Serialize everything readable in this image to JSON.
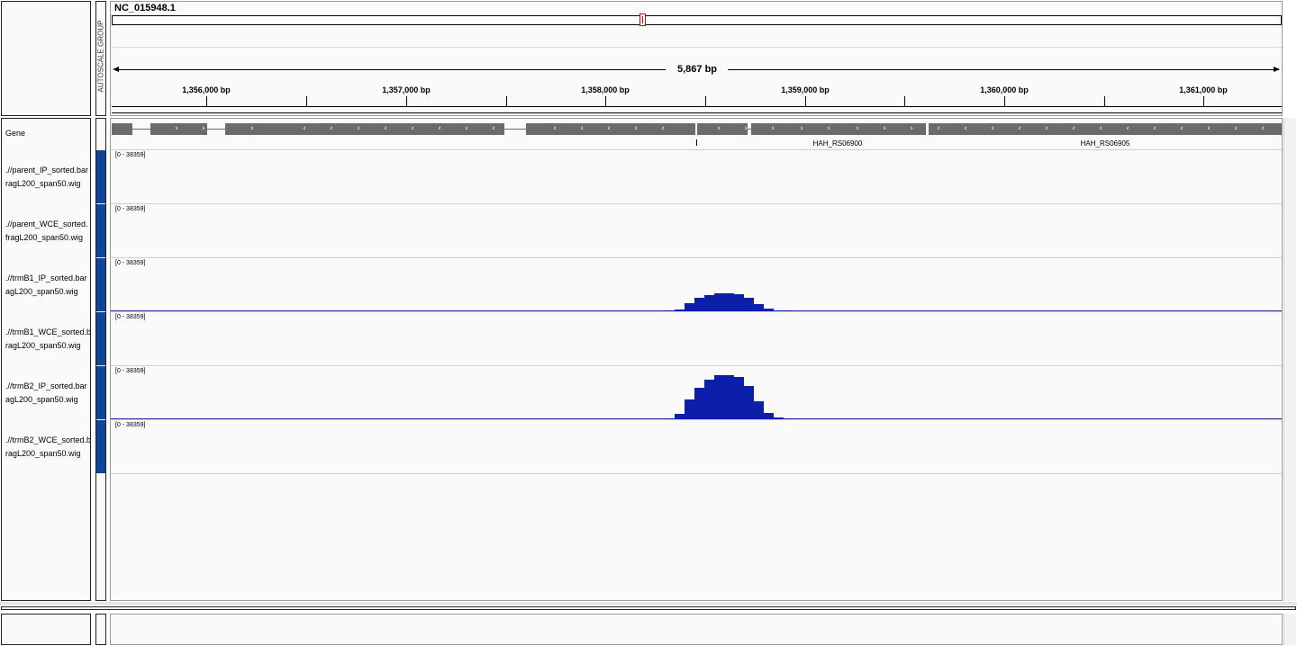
{
  "chromosome": "NC_015948.1",
  "attribute_header": "AUTOSCALE GROUP",
  "ruler": {
    "span_label": "5,867 bp",
    "tick_labels": [
      "1,356,000 bp",
      "1,357,000 bp",
      "1,358,000 bp",
      "1,359,000 bp",
      "1,360,000 bp",
      "1,361,000 bp"
    ]
  },
  "gene_track": {
    "name": "Gene",
    "labels": [
      "HAH_RS06900",
      "HAH_RS06905"
    ]
  },
  "data_range_label": "[0 - 38359]",
  "tracks": [
    {
      "name_line1": ".//parent_IP_sorted.bar",
      "name_line2": "ragL200_span50.wig",
      "peak_fraction": 0
    },
    {
      "name_line1": ".//parent_WCE_sorted.",
      "name_line2": "fragL200_span50.wig",
      "peak_fraction": 0
    },
    {
      "name_line1": ".//trmB1_IP_sorted.bar",
      "name_line2": "agL200_span50.wig",
      "peak_fraction": 0.35
    },
    {
      "name_line1": ".//trmB1_WCE_sorted.b",
      "name_line2": "ragL200_span50.wig",
      "peak_fraction": 0
    },
    {
      "name_line1": ".//trmB2_IP_sorted.bar",
      "name_line2": "agL200_span50.wig",
      "peak_fraction": 0.85
    },
    {
      "name_line1": ".//trmB2_WCE_sorted.b",
      "name_line2": "ragL200_span50.wig",
      "peak_fraction": 0
    }
  ],
  "colors": {
    "coverage": "#0b1fa8",
    "attribute_block": "#0e479a",
    "gene": "#6b6b6b",
    "region_marker": "#e00000"
  }
}
